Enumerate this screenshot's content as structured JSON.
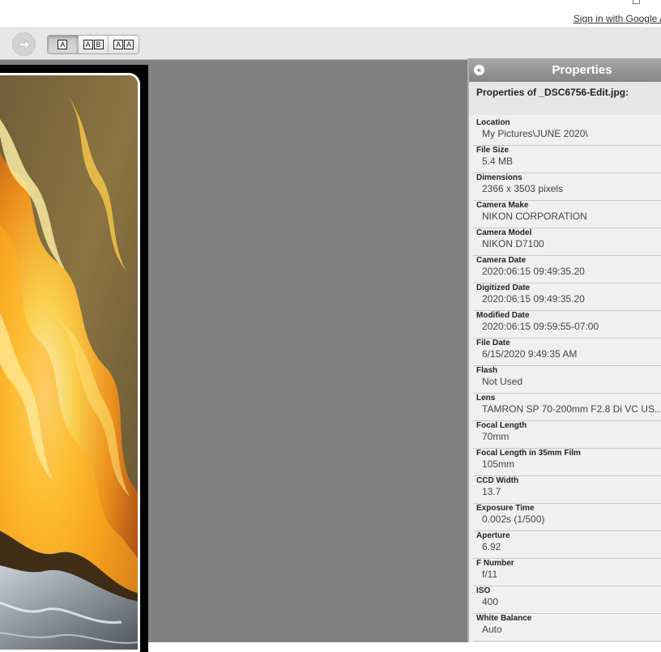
{
  "header": {
    "signin_link": "Sign in with Google A"
  },
  "toolbar": {
    "next_icon": "arrow-right-icon",
    "layouts": [
      {
        "letters": [
          "A"
        ],
        "active": true
      },
      {
        "letters": [
          "A",
          "B"
        ],
        "active": false
      },
      {
        "letters": [
          "A",
          "A"
        ],
        "active": false
      }
    ]
  },
  "properties": {
    "title": "Properties",
    "collapse_icon": "double-chevron-left-icon",
    "subtitle": "Properties of _DSC6756-Edit.jpg:",
    "rows": [
      {
        "label": "Location",
        "value": "My Pictures\\JUNE 2020\\"
      },
      {
        "label": "File Size",
        "value": "5.4 MB"
      },
      {
        "label": "Dimensions",
        "value": "2366 x 3503 pixels"
      },
      {
        "label": "Camera Make",
        "value": "NIKON CORPORATION"
      },
      {
        "label": "Camera Model",
        "value": "NIKON D7100"
      },
      {
        "label": "Camera Date",
        "value": "2020:06:15 09:49:35.20"
      },
      {
        "label": "Digitized Date",
        "value": "2020:06:15 09:49:35.20"
      },
      {
        "label": "Modified Date",
        "value": "2020:06:15 09:59:55-07:00"
      },
      {
        "label": "File Date",
        "value": "6/15/2020 9:49:35 AM"
      },
      {
        "label": "Flash",
        "value": "Not Used"
      },
      {
        "label": "Lens",
        "value": "TAMRON SP 70-200mm F2.8 Di VC US..."
      },
      {
        "label": "Focal Length",
        "value": "70mm"
      },
      {
        "label": "Focal Length in 35mm Film",
        "value": "105mm"
      },
      {
        "label": "CCD Width",
        "value": "13.7"
      },
      {
        "label": "Exposure Time",
        "value": "0.002s (1/500)"
      },
      {
        "label": "Aperture",
        "value": "6.92"
      },
      {
        "label": "F Number",
        "value": "f/11"
      },
      {
        "label": "ISO",
        "value": "400"
      },
      {
        "label": "White Balance",
        "value": "Auto"
      }
    ]
  },
  "colors": {
    "viewer_bg": "#808080",
    "panel_bg": "#f0f0f0",
    "header_bg": "#959595"
  }
}
